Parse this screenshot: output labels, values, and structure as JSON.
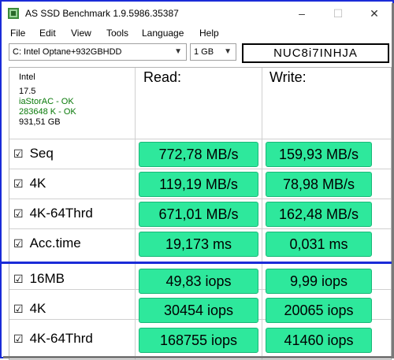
{
  "window": {
    "title": "AS SSD Benchmark 1.9.5986.35387",
    "minimize": "–",
    "maximize": "☐",
    "close": "✕"
  },
  "menu": [
    "File",
    "Edit",
    "View",
    "Tools",
    "Language",
    "Help"
  ],
  "drive_select": {
    "value": "C: Intel Optane+932GBHDD"
  },
  "size_select": {
    "value": "1 GB"
  },
  "device_name": "NUC8i7INHJA",
  "drive_info": {
    "vendor": "Intel",
    "firmware": "17.5",
    "driver": "iaStorAC - OK",
    "alignment": "283648 K - OK",
    "capacity": "931,51 GB"
  },
  "columns": {
    "read": "Read:",
    "write": "Write:"
  },
  "rows": [
    {
      "label": "Seq",
      "checked": "☑",
      "read": "772,78 MB/s",
      "write": "159,93 MB/s"
    },
    {
      "label": "4K",
      "checked": "☑",
      "read": "119,19 MB/s",
      "write": "78,98 MB/s"
    },
    {
      "label": "4K-64Thrd",
      "checked": "☑",
      "read": "671,01 MB/s",
      "write": "162,48 MB/s"
    },
    {
      "label": "Acc.time",
      "checked": "☑",
      "read": "19,173 ms",
      "write": "0,031 ms"
    },
    {
      "label": "16MB",
      "checked": "☑",
      "read": "49,83 iops",
      "write": "9,99 iops"
    },
    {
      "label": "4K",
      "checked": "☑",
      "read": "30454 iops",
      "write": "20065 iops"
    },
    {
      "label": "4K-64Thrd",
      "checked": "☑",
      "read": "168755 iops",
      "write": "41460 iops"
    }
  ],
  "colors": {
    "value_fill": "#2ee89c",
    "border_accent": "#1a2bd8",
    "ok_text": "#0a7a0a"
  }
}
